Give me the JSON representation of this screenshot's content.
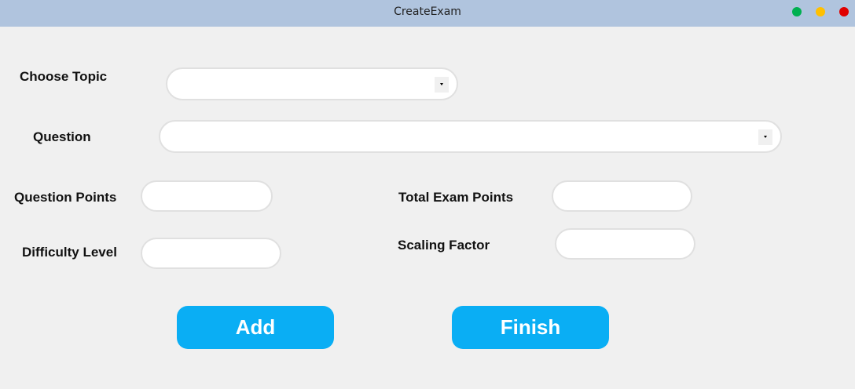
{
  "window": {
    "title": "CreateExam"
  },
  "form": {
    "choose_topic_label": "Choose Topic",
    "question_label": "Question",
    "question_points_label": "Question Points",
    "difficulty_level_label": "Difficulty Level",
    "total_exam_points_label": "Total Exam Points",
    "scaling_factor_label": "Scaling Factor",
    "choose_topic_value": "",
    "question_value": "",
    "question_points_value": "",
    "difficulty_level_value": "",
    "total_exam_points_value": "",
    "scaling_factor_value": ""
  },
  "buttons": {
    "add_label": "Add",
    "finish_label": "Finish"
  },
  "colors": {
    "titlebar": "#b0c4de",
    "button": "#0aaef4",
    "window_green": "#00b050",
    "window_yellow": "#ffc000",
    "window_red": "#e00000"
  }
}
